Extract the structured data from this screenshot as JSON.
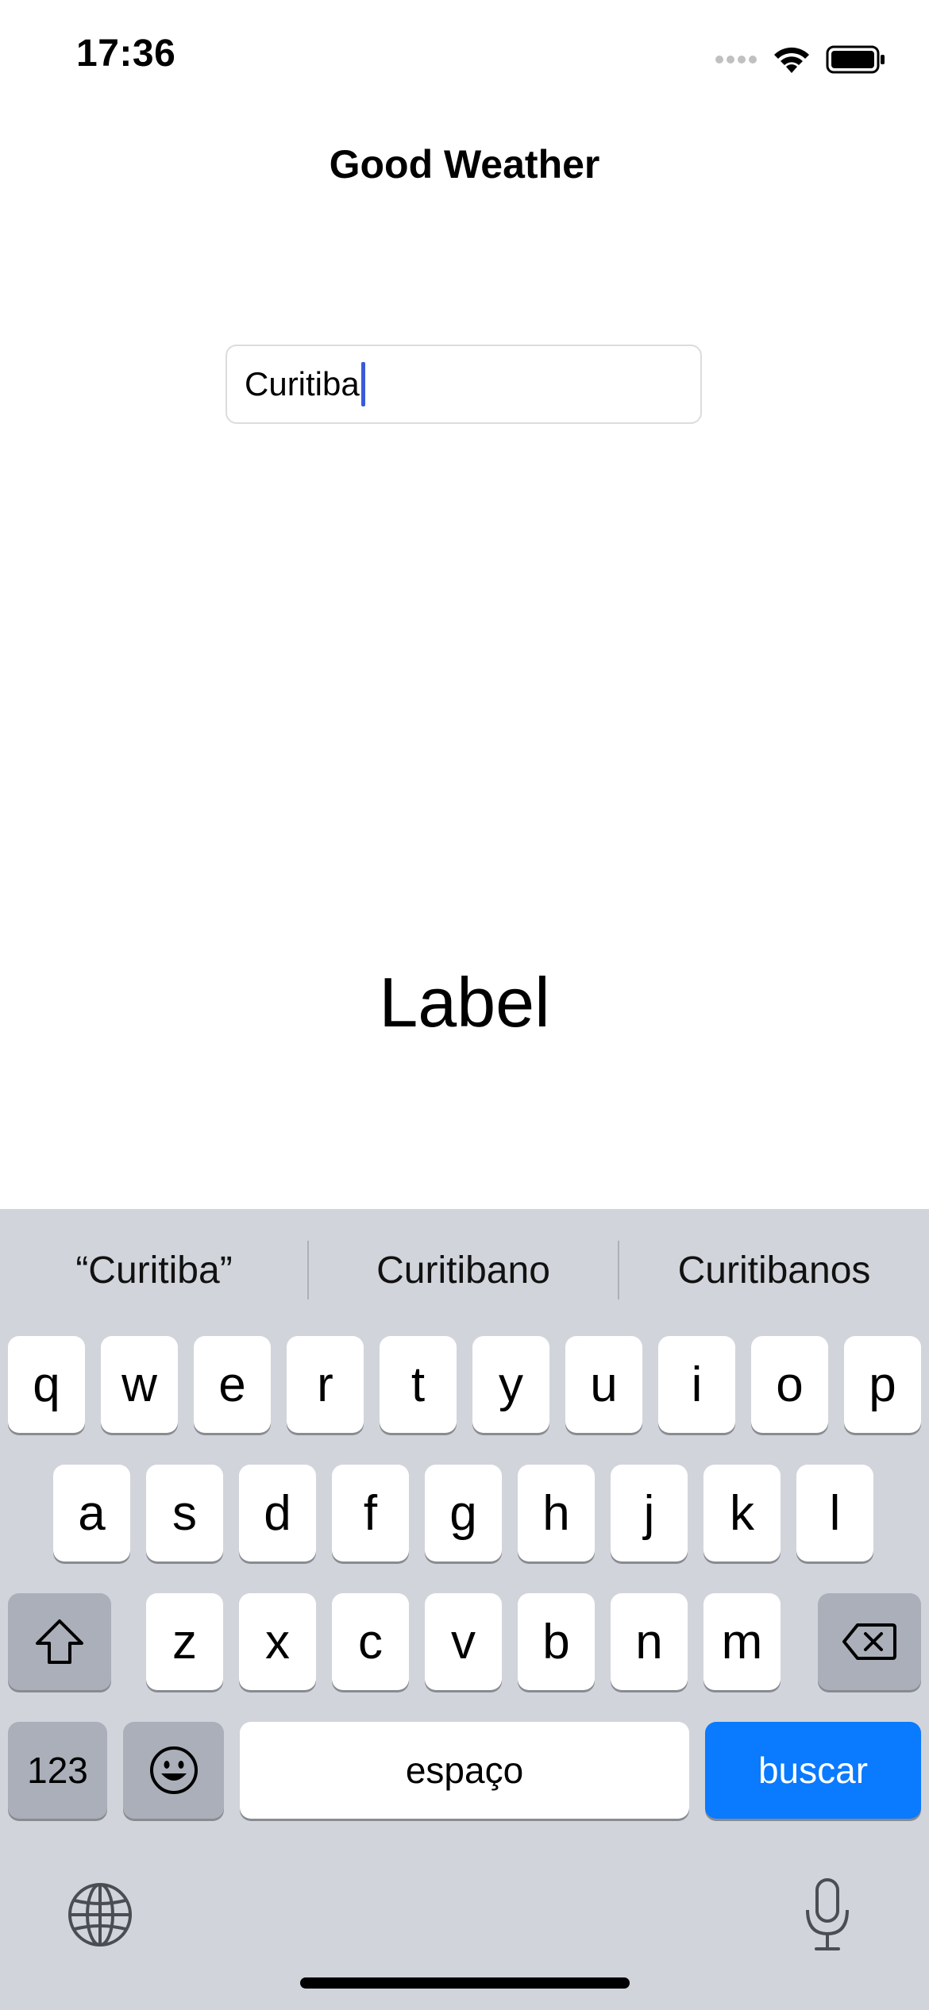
{
  "status_bar": {
    "time": "17:36",
    "icons": [
      "signal-dots-icon",
      "wifi-icon",
      "battery-icon"
    ]
  },
  "nav": {
    "title": "Good Weather"
  },
  "city_field": {
    "value": "Curitiba"
  },
  "main_label": "Label",
  "keyboard": {
    "suggestions": [
      "“Curitiba”",
      "Curitibano",
      "Curitibanos"
    ],
    "row1": [
      "q",
      "w",
      "e",
      "r",
      "t",
      "y",
      "u",
      "i",
      "o",
      "p"
    ],
    "row2": [
      "a",
      "s",
      "d",
      "f",
      "g",
      "h",
      "j",
      "k",
      "l"
    ],
    "row3": [
      "z",
      "x",
      "c",
      "v",
      "b",
      "n",
      "m"
    ],
    "numbers_key": "123",
    "space_key": "espaço",
    "return_key": "buscar",
    "colors": {
      "background": "#d1d4db",
      "key": "#ffffff",
      "special_key": "#abafb9",
      "return_key": "#0a7aff"
    }
  }
}
